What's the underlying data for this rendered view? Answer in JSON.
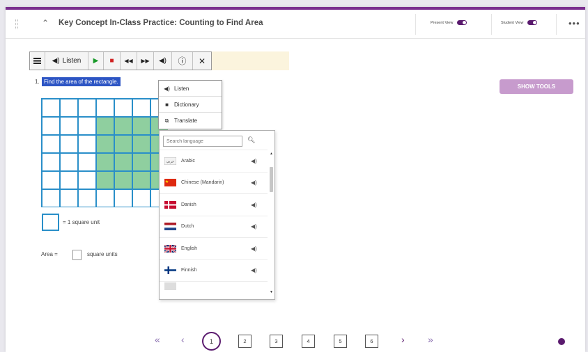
{
  "header": {
    "title": "Key Concept In-Class Practice: Counting to Find Area",
    "present_view": "Present View",
    "student_view": "Student View"
  },
  "toolbar": {
    "listen_label": "Listen"
  },
  "question": {
    "number": "1.",
    "text": "Find the area of the rectangle.",
    "unit_legend": "= 1 square unit",
    "area_label": "Area =",
    "area_units": "square units"
  },
  "grid": {
    "columns": 7,
    "rows": 6,
    "shaded_columns": [
      3,
      6
    ],
    "shaded_rows": [
      1,
      4
    ]
  },
  "show_tools_label": "SHOW TOOLS",
  "context_menu": {
    "items": [
      {
        "label": "Listen",
        "icon": "speaker-icon"
      },
      {
        "label": "Dictionary",
        "icon": "book-icon"
      },
      {
        "label": "Translate",
        "icon": "translate-icon"
      }
    ]
  },
  "language_panel": {
    "search_placeholder": "Search language",
    "languages": [
      {
        "name": "Arabic",
        "flag": "arabic"
      },
      {
        "name": "Chinese (Mandarin)",
        "flag": "china"
      },
      {
        "name": "Danish",
        "flag": "denmark"
      },
      {
        "name": "Dutch",
        "flag": "netherlands"
      },
      {
        "name": "English",
        "flag": "uk"
      },
      {
        "name": "Finnish",
        "flag": "finland"
      }
    ]
  },
  "pager": {
    "current": "1",
    "pages": [
      "2",
      "3",
      "4",
      "5",
      "6"
    ]
  },
  "colors": {
    "accent": "#5a1a6e",
    "grid_line": "#2a8fc9",
    "grid_fill": "#8fcf9f",
    "selection": "#2d55c4",
    "show_tools_bg": "#c79bcd"
  }
}
